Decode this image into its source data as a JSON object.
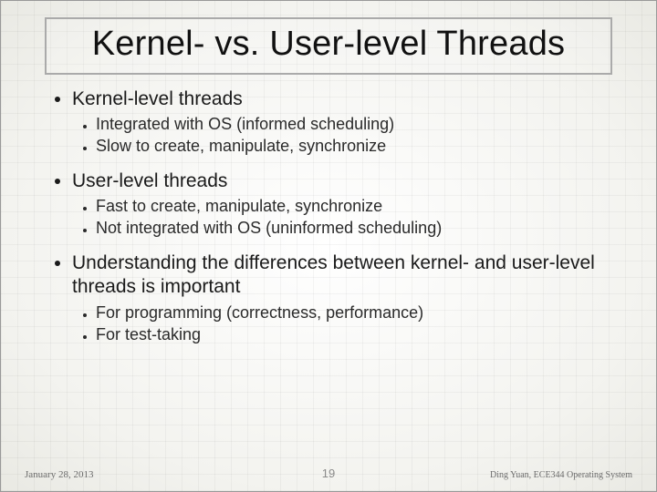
{
  "title": "Kernel- vs. User-level Threads",
  "sections": [
    {
      "heading": "Kernel-level threads",
      "items": [
        "Integrated with OS (informed scheduling)",
        "Slow to create, manipulate, synchronize"
      ]
    },
    {
      "heading": "User-level threads",
      "items": [
        "Fast to create, manipulate, synchronize",
        "Not integrated with OS (uninformed scheduling)"
      ]
    },
    {
      "heading": "Understanding the differences between kernel- and user-level threads is important",
      "items": [
        "For programming (correctness, performance)",
        "For test-taking"
      ]
    }
  ],
  "footer": {
    "date": "January 28, 2013",
    "page": "19",
    "author": "Ding Yuan, ECE344 Operating System"
  }
}
